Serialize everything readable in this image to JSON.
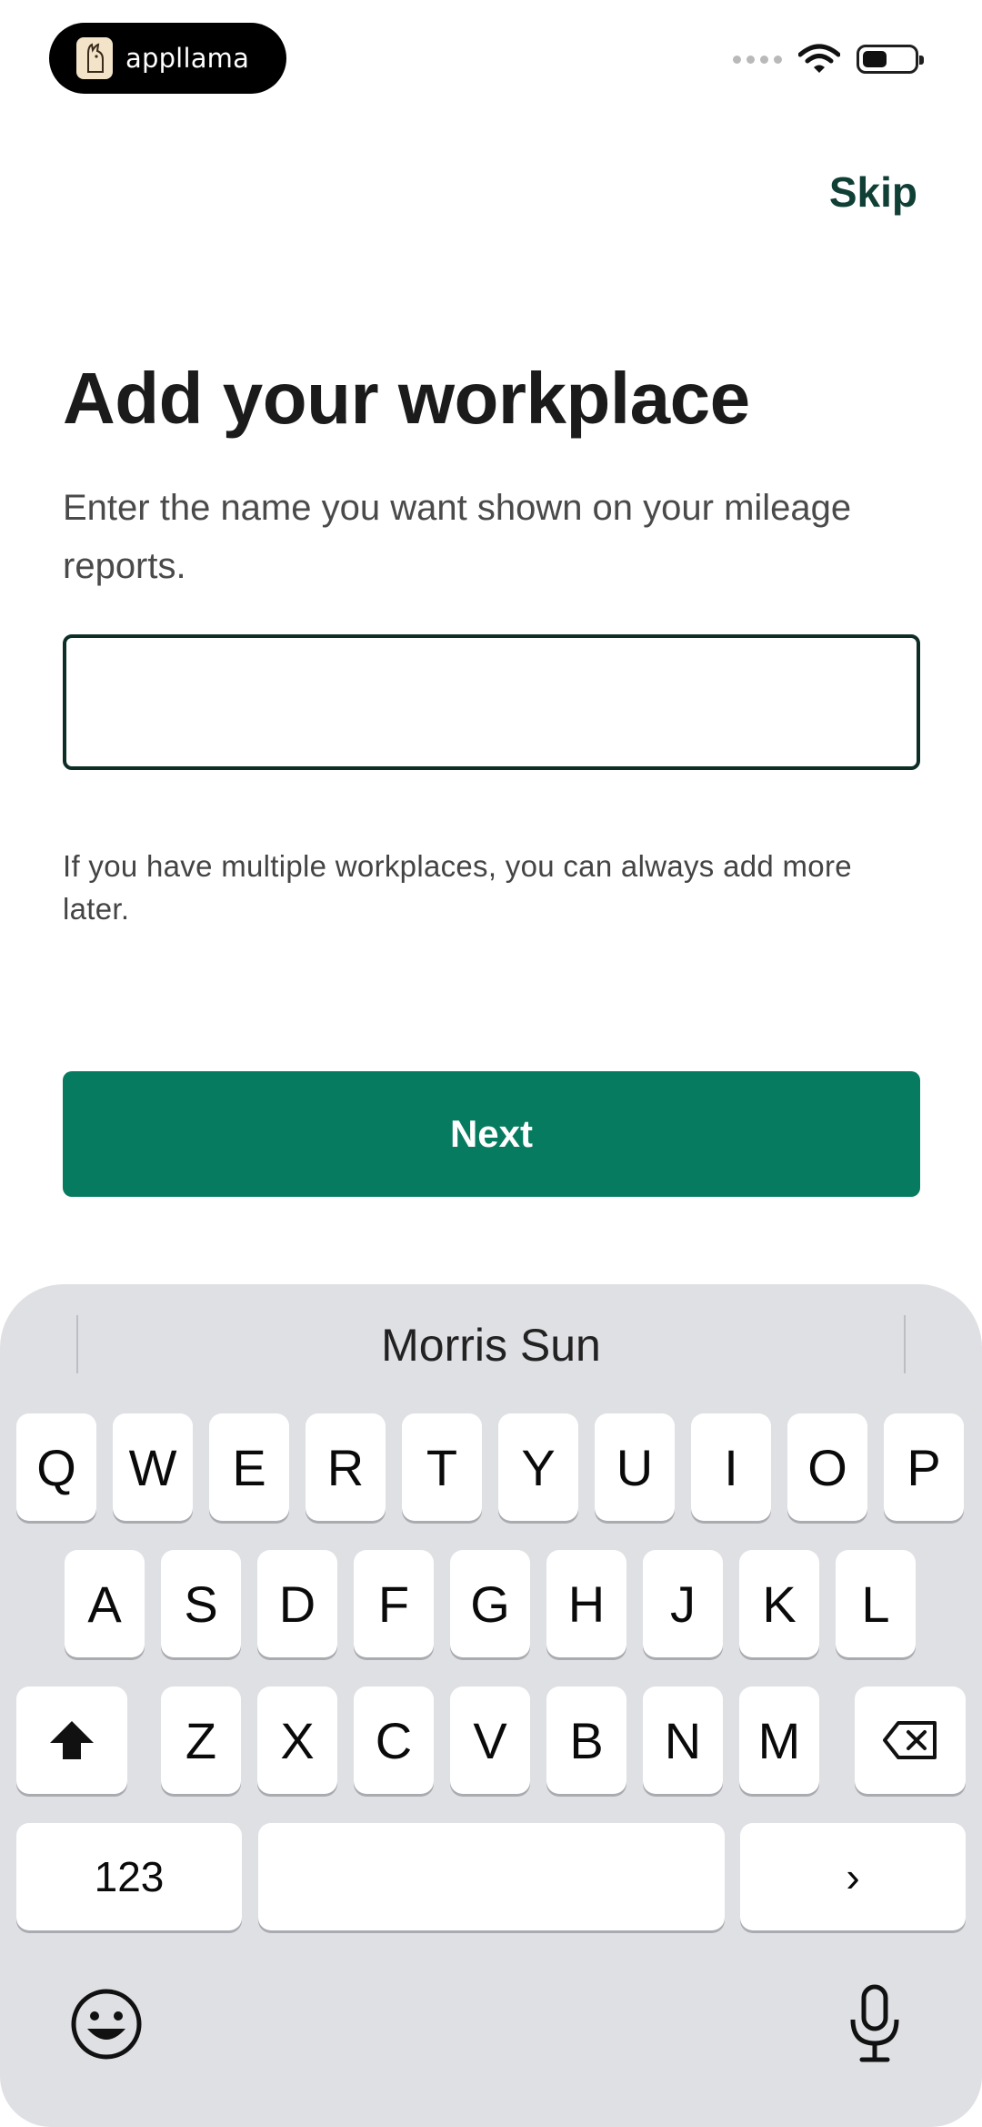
{
  "status_bar": {
    "brand": "appllama"
  },
  "header": {
    "skip_label": "Skip"
  },
  "main": {
    "title": "Add your workplace",
    "subtitle": "Enter the name you want shown on your mileage reports.",
    "input_value": "",
    "hint": "If you have multiple workplaces, you can always add more later.",
    "next_label": "Next"
  },
  "keyboard": {
    "suggestion": "Morris Sun",
    "row1": [
      "Q",
      "W",
      "E",
      "R",
      "T",
      "Y",
      "U",
      "I",
      "O",
      "P"
    ],
    "row2": [
      "A",
      "S",
      "D",
      "F",
      "G",
      "H",
      "J",
      "K",
      "L"
    ],
    "row3": [
      "Z",
      "X",
      "C",
      "V",
      "B",
      "N",
      "M"
    ],
    "numbers_label": "123",
    "return_glyph": "›",
    "icons": [
      "shift-icon",
      "delete-icon",
      "emoji-icon",
      "microphone-icon"
    ]
  },
  "colors": {
    "accent": "#067b60",
    "input_border": "#0d2e27",
    "skip": "#0f3f35",
    "keyboard_bg": "#dfe0e4"
  }
}
